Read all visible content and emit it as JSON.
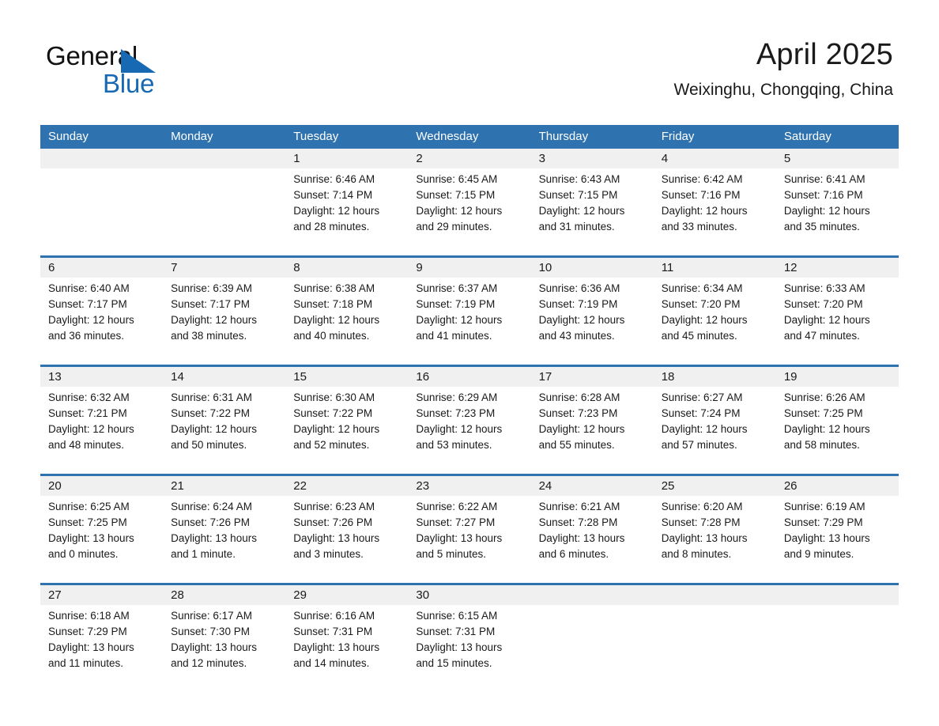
{
  "brand": {
    "name_part1": "General",
    "name_part2": "Blue",
    "logo_icon": "triangle-mark",
    "accent_color": "#1769b3"
  },
  "header": {
    "month_title": "April 2025",
    "location": "Weixinghu, Chongqing, China"
  },
  "calendar": {
    "header_color": "#2e72b0",
    "daynum_band_color": "#f0f0f0",
    "weekdays": [
      "Sunday",
      "Monday",
      "Tuesday",
      "Wednesday",
      "Thursday",
      "Friday",
      "Saturday"
    ],
    "weeks": [
      [
        {
          "day": "",
          "detail": ""
        },
        {
          "day": "",
          "detail": ""
        },
        {
          "day": "1",
          "detail": "Sunrise: 6:46 AM\nSunset: 7:14 PM\nDaylight: 12 hours\nand 28 minutes."
        },
        {
          "day": "2",
          "detail": "Sunrise: 6:45 AM\nSunset: 7:15 PM\nDaylight: 12 hours\nand 29 minutes."
        },
        {
          "day": "3",
          "detail": "Sunrise: 6:43 AM\nSunset: 7:15 PM\nDaylight: 12 hours\nand 31 minutes."
        },
        {
          "day": "4",
          "detail": "Sunrise: 6:42 AM\nSunset: 7:16 PM\nDaylight: 12 hours\nand 33 minutes."
        },
        {
          "day": "5",
          "detail": "Sunrise: 6:41 AM\nSunset: 7:16 PM\nDaylight: 12 hours\nand 35 minutes."
        }
      ],
      [
        {
          "day": "6",
          "detail": "Sunrise: 6:40 AM\nSunset: 7:17 PM\nDaylight: 12 hours\nand 36 minutes."
        },
        {
          "day": "7",
          "detail": "Sunrise: 6:39 AM\nSunset: 7:17 PM\nDaylight: 12 hours\nand 38 minutes."
        },
        {
          "day": "8",
          "detail": "Sunrise: 6:38 AM\nSunset: 7:18 PM\nDaylight: 12 hours\nand 40 minutes."
        },
        {
          "day": "9",
          "detail": "Sunrise: 6:37 AM\nSunset: 7:19 PM\nDaylight: 12 hours\nand 41 minutes."
        },
        {
          "day": "10",
          "detail": "Sunrise: 6:36 AM\nSunset: 7:19 PM\nDaylight: 12 hours\nand 43 minutes."
        },
        {
          "day": "11",
          "detail": "Sunrise: 6:34 AM\nSunset: 7:20 PM\nDaylight: 12 hours\nand 45 minutes."
        },
        {
          "day": "12",
          "detail": "Sunrise: 6:33 AM\nSunset: 7:20 PM\nDaylight: 12 hours\nand 47 minutes."
        }
      ],
      [
        {
          "day": "13",
          "detail": "Sunrise: 6:32 AM\nSunset: 7:21 PM\nDaylight: 12 hours\nand 48 minutes."
        },
        {
          "day": "14",
          "detail": "Sunrise: 6:31 AM\nSunset: 7:22 PM\nDaylight: 12 hours\nand 50 minutes."
        },
        {
          "day": "15",
          "detail": "Sunrise: 6:30 AM\nSunset: 7:22 PM\nDaylight: 12 hours\nand 52 minutes."
        },
        {
          "day": "16",
          "detail": "Sunrise: 6:29 AM\nSunset: 7:23 PM\nDaylight: 12 hours\nand 53 minutes."
        },
        {
          "day": "17",
          "detail": "Sunrise: 6:28 AM\nSunset: 7:23 PM\nDaylight: 12 hours\nand 55 minutes."
        },
        {
          "day": "18",
          "detail": "Sunrise: 6:27 AM\nSunset: 7:24 PM\nDaylight: 12 hours\nand 57 minutes."
        },
        {
          "day": "19",
          "detail": "Sunrise: 6:26 AM\nSunset: 7:25 PM\nDaylight: 12 hours\nand 58 minutes."
        }
      ],
      [
        {
          "day": "20",
          "detail": "Sunrise: 6:25 AM\nSunset: 7:25 PM\nDaylight: 13 hours\nand 0 minutes."
        },
        {
          "day": "21",
          "detail": "Sunrise: 6:24 AM\nSunset: 7:26 PM\nDaylight: 13 hours\nand 1 minute."
        },
        {
          "day": "22",
          "detail": "Sunrise: 6:23 AM\nSunset: 7:26 PM\nDaylight: 13 hours\nand 3 minutes."
        },
        {
          "day": "23",
          "detail": "Sunrise: 6:22 AM\nSunset: 7:27 PM\nDaylight: 13 hours\nand 5 minutes."
        },
        {
          "day": "24",
          "detail": "Sunrise: 6:21 AM\nSunset: 7:28 PM\nDaylight: 13 hours\nand 6 minutes."
        },
        {
          "day": "25",
          "detail": "Sunrise: 6:20 AM\nSunset: 7:28 PM\nDaylight: 13 hours\nand 8 minutes."
        },
        {
          "day": "26",
          "detail": "Sunrise: 6:19 AM\nSunset: 7:29 PM\nDaylight: 13 hours\nand 9 minutes."
        }
      ],
      [
        {
          "day": "27",
          "detail": "Sunrise: 6:18 AM\nSunset: 7:29 PM\nDaylight: 13 hours\nand 11 minutes."
        },
        {
          "day": "28",
          "detail": "Sunrise: 6:17 AM\nSunset: 7:30 PM\nDaylight: 13 hours\nand 12 minutes."
        },
        {
          "day": "29",
          "detail": "Sunrise: 6:16 AM\nSunset: 7:31 PM\nDaylight: 13 hours\nand 14 minutes."
        },
        {
          "day": "30",
          "detail": "Sunrise: 6:15 AM\nSunset: 7:31 PM\nDaylight: 13 hours\nand 15 minutes."
        },
        {
          "day": "",
          "detail": ""
        },
        {
          "day": "",
          "detail": ""
        },
        {
          "day": "",
          "detail": ""
        }
      ]
    ]
  }
}
